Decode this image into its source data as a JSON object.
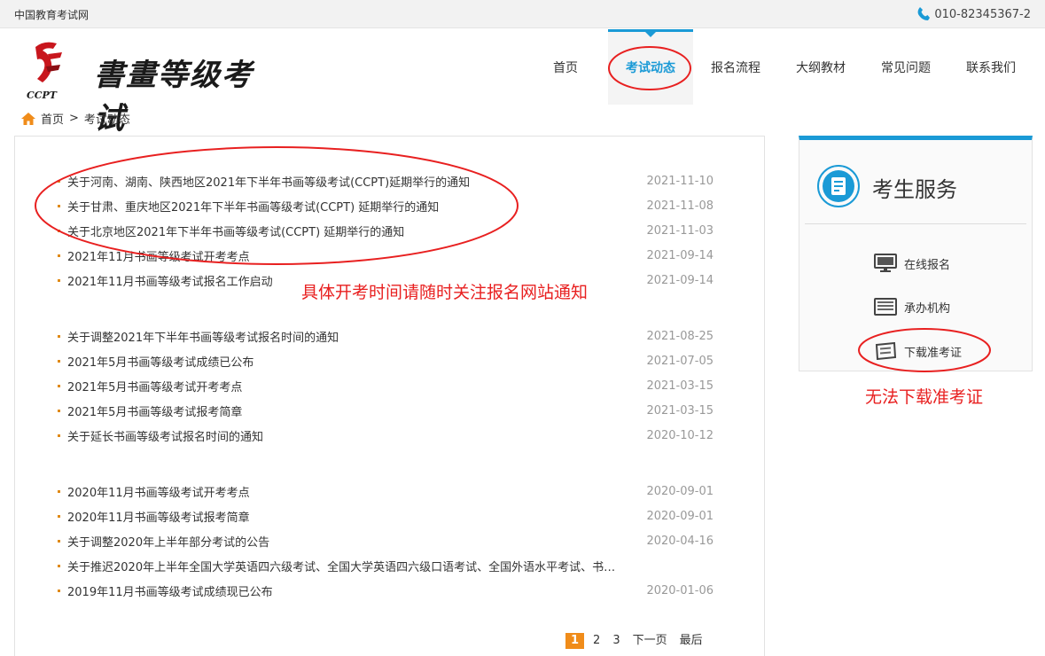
{
  "topbar": {
    "site_name": "中国教育考试网",
    "phone": "010-82345367-2"
  },
  "logo": {
    "text": "書畫等级考试",
    "abbr": "CCPT"
  },
  "nav": [
    {
      "label": "首页",
      "active": false
    },
    {
      "label": "考试动态",
      "active": true
    },
    {
      "label": "报名流程",
      "active": false
    },
    {
      "label": "大纲教材",
      "active": false
    },
    {
      "label": "常见问题",
      "active": false
    },
    {
      "label": "联系我们",
      "active": false
    }
  ],
  "breadcrumb": {
    "home": "首页",
    "separator": ">",
    "current": "考试动态"
  },
  "news_groups": [
    [
      {
        "title": "关于河南、湖南、陕西地区2021年下半年书画等级考试(CCPT)延期举行的通知",
        "date": "2021-11-10"
      },
      {
        "title": "关于甘肃、重庆地区2021年下半年书画等级考试(CCPT) 延期举行的通知",
        "date": "2021-11-08"
      },
      {
        "title": "关于北京地区2021年下半年书画等级考试(CCPT) 延期举行的通知",
        "date": "2021-11-03"
      },
      {
        "title": "2021年11月书画等级考试开考考点",
        "date": "2021-09-14"
      },
      {
        "title": "2021年11月书画等级考试报名工作启动",
        "date": "2021-09-14"
      }
    ],
    [
      {
        "title": "关于调整2021年下半年书画等级考试报名时间的通知",
        "date": "2021-08-25"
      },
      {
        "title": "2021年5月书画等级考试成绩已公布",
        "date": "2021-07-05"
      },
      {
        "title": "2021年5月书画等级考试开考考点",
        "date": "2021-03-15"
      },
      {
        "title": "2021年5月书画等级考试报考简章",
        "date": "2021-03-15"
      },
      {
        "title": "关于延长书画等级考试报名时间的通知",
        "date": "2020-10-12"
      }
    ],
    [
      {
        "title": "2020年11月书画等级考试开考考点",
        "date": "2020-09-01"
      },
      {
        "title": "2020年11月书画等级考试报考简章",
        "date": "2020-09-01"
      },
      {
        "title": "关于调整2020年上半年部分考试的公告",
        "date": "2020-04-16"
      },
      {
        "title": "关于推迟2020年上半年全国大学英语四六级考试、全国大学英语四六级口语考试、全国外语水平考试、书…",
        "date": ""
      },
      {
        "title": "2019年11月书画等级考试成绩现已公布",
        "date": "2020-01-06"
      }
    ]
  ],
  "pager": {
    "pages": [
      "1",
      "2",
      "3"
    ],
    "current": "1",
    "next": "下一页",
    "last": "最后"
  },
  "side": {
    "title": "考生服务",
    "items": [
      {
        "label": "在线报名",
        "icon": "monitor-icon"
      },
      {
        "label": "承办机构",
        "icon": "keyboard-icon"
      },
      {
        "label": "下载准考证",
        "icon": "ticket-icon"
      }
    ]
  },
  "annotations": {
    "note_main": "具体开考时间请随时关注报名网站通知",
    "note_side": "无法下载准考证",
    "color": "#e82020"
  },
  "colors": {
    "accent": "#1a9ad6",
    "bullet": "#e08a16",
    "pager_active": "#f08c1a"
  }
}
